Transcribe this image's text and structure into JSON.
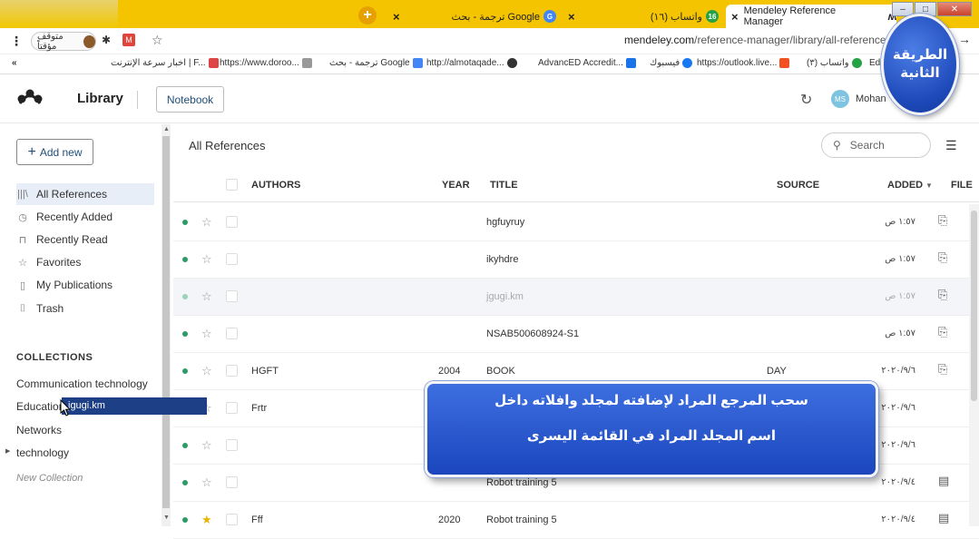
{
  "browser": {
    "tabs": [
      {
        "label": "ترجمة - بحث Google",
        "badge": "G",
        "badge_color": "#4285f4"
      },
      {
        "label": "(١٦) واتساب",
        "badge": "16",
        "badge_color": "#25a244"
      },
      {
        "label": "Mendeley Reference Manager",
        "active": true
      }
    ],
    "profile_chip": "متوقف مؤقتاً",
    "url_domain": "mendeley.com",
    "url_path": "/reference-manager/library/all-references/",
    "bookmarks": [
      {
        "label": "اخبار سرعة الإنترنت | F...",
        "icon_color": "#d44"
      },
      {
        "label": "https://www.doroo...",
        "icon_color": "#999"
      },
      {
        "label": "ترجمة - بحث Google",
        "icon_color": "#4285f4"
      },
      {
        "label": "http://almotaqade...",
        "icon_color": "#333"
      },
      {
        "label": "AdvancED Accredit...",
        "icon_color": "#1a73e8"
      },
      {
        "label": "فيسبوك",
        "icon_color": "#1877f2"
      },
      {
        "label": "https://outlook.live...",
        "icon_color": "#f25022"
      },
      {
        "label": "(٣) واتساب",
        "icon_color": "#25a244"
      },
      {
        "label": "Ed",
        "icon_color": "#333"
      }
    ],
    "bookmarks_toggle": "«"
  },
  "app": {
    "library_label": "Library",
    "notebook_label": "Notebook",
    "user_initials": "MS",
    "user_name": "Mohan",
    "add_new_label": "Add new",
    "nav": [
      {
        "label": "All References",
        "icon": "library-icon",
        "glyph": "|||\\",
        "selected": true
      },
      {
        "label": "Recently Added",
        "icon": "clock-icon",
        "glyph": "◷"
      },
      {
        "label": "Recently Read",
        "icon": "bookmark-icon",
        "glyph": "⊓"
      },
      {
        "label": "Favorites",
        "icon": "star-icon",
        "glyph": "☆"
      },
      {
        "label": "My Publications",
        "icon": "document-icon",
        "glyph": "▯"
      },
      {
        "label": "Trash",
        "icon": "trash-icon",
        "glyph": "🗑"
      }
    ],
    "collections_heading": "COLLECTIONS",
    "collections": [
      "Communication technology",
      "Education",
      "Networks",
      "technology"
    ],
    "new_collection_label": "New Collection",
    "drag_ghost_text": "jgugi.km",
    "list_title": "All References",
    "search_placeholder": "Search",
    "columns": {
      "authors": "AUTHORS",
      "year": "YEAR",
      "title": "TITLE",
      "source": "SOURCE",
      "added": "ADDED",
      "file": "FILE"
    },
    "rows": [
      {
        "author": "",
        "year": "",
        "title": "hgfuyruy",
        "source": "",
        "added": "١:٥٧ ص",
        "starred": false,
        "highlighted": false,
        "file_icon": "pdf-add-icon"
      },
      {
        "author": "",
        "year": "",
        "title": "ikyhdre",
        "source": "",
        "added": "١:٥٧ ص",
        "starred": false,
        "highlighted": false,
        "file_icon": "pdf-add-icon"
      },
      {
        "author": "",
        "year": "",
        "title": "jgugi.km",
        "source": "",
        "added": "١:٥٧ ص",
        "starred": false,
        "highlighted": true,
        "file_icon": "pdf-add-icon"
      },
      {
        "author": "",
        "year": "",
        "title": "NSAB500608924-S1",
        "source": "",
        "added": "١:٥٧ ص",
        "starred": false,
        "highlighted": false,
        "file_icon": "pdf-add-icon"
      },
      {
        "author": "HGFT",
        "year": "2004",
        "title": "BOOK",
        "source": "DAY",
        "added": "٢٠٢٠/٩/٦",
        "starred": false,
        "highlighted": false,
        "file_icon": "pdf-add-icon"
      },
      {
        "author": "Frtr",
        "year": "",
        "title": "",
        "source": "",
        "added": "٢٠٢٠/٩/٦",
        "starred": false,
        "highlighted": false,
        "file_icon": ""
      },
      {
        "author": "",
        "year": "",
        "title": "",
        "source": "",
        "added": "٢٠٢٠/٩/٦",
        "starred": false,
        "highlighted": false,
        "file_icon": ""
      },
      {
        "author": "",
        "year": "",
        "title": "Robot training 5",
        "source": "",
        "added": "٢٠٢٠/٩/٤",
        "starred": false,
        "highlighted": false,
        "file_icon": "file-icon"
      },
      {
        "author": "Fff",
        "year": "2020",
        "title": "Robot training 5",
        "source": "",
        "added": "٢٠٢٠/٩/٤",
        "starred": true,
        "highlighted": false,
        "file_icon": "file-icon"
      }
    ]
  },
  "overlay": {
    "bubble_line1": "الطريقة",
    "bubble_line2": "الثانية",
    "callout_line1": "سحب المرجع المراد لإضافته لمجلد وافلاته داخل",
    "callout_line2": "اسم المجلد المراد في القائمة اليسرى"
  }
}
